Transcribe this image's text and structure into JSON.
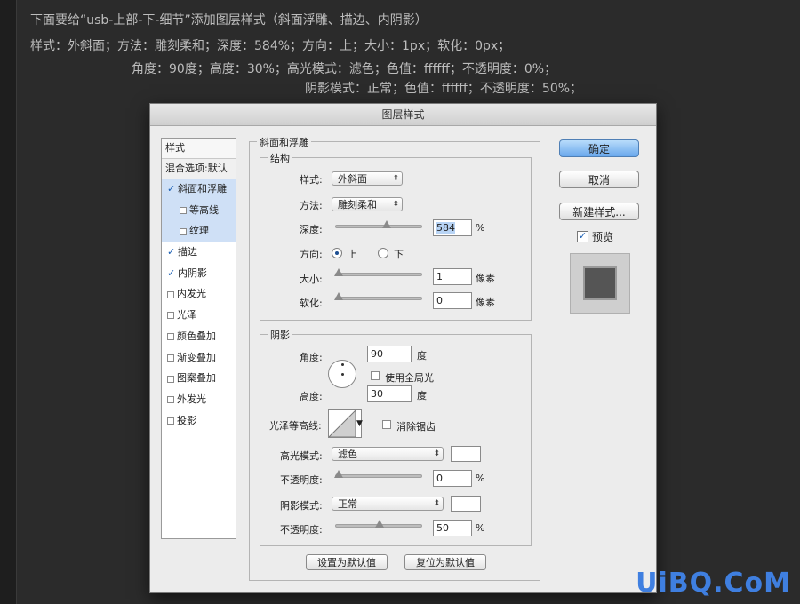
{
  "header": {
    "line1": "下面要给“usb-上部-下-细节”添加图层样式（斜面浮雕、描边、内阴影）",
    "line2": "样式：外斜面；方法：雕刻柔和；深度：584%；方向：上；大小：1px；软化：0px；",
    "line3": "角度：90度；高度：30%；高光模式：滤色；色值：ffffff；不透明度：0%；",
    "line4": "阴影模式：正常；色值：ffffff；不透明度：50%；"
  },
  "dialog": {
    "title": "图层样式",
    "style_list": {
      "header": "样式",
      "blend": "混合选项:默认",
      "items": [
        {
          "label": "斜面和浮雕",
          "checked": true,
          "selected": true
        },
        {
          "label": "等高线",
          "checked": false,
          "selected": true,
          "sub": true
        },
        {
          "label": "纹理",
          "checked": false,
          "selected": true,
          "sub": true
        },
        {
          "label": "描边",
          "checked": true
        },
        {
          "label": "内阴影",
          "checked": true
        },
        {
          "label": "内发光",
          "checked": false
        },
        {
          "label": "光泽",
          "checked": false
        },
        {
          "label": "颜色叠加",
          "checked": false
        },
        {
          "label": "渐变叠加",
          "checked": false
        },
        {
          "label": "图案叠加",
          "checked": false
        },
        {
          "label": "外发光",
          "checked": false
        },
        {
          "label": "投影",
          "checked": false
        }
      ]
    },
    "buttons": {
      "ok": "确定",
      "cancel": "取消",
      "new_style": "新建样式...",
      "preview": "预览"
    },
    "bevel": {
      "group_title": "斜面和浮雕",
      "structure_title": "结构",
      "style_label": "样式:",
      "style_value": "外斜面",
      "technique_label": "方法:",
      "technique_value": "雕刻柔和",
      "depth_label": "深度:",
      "depth_value": "584",
      "depth_unit": "%",
      "direction_label": "方向:",
      "direction_up": "上",
      "direction_down": "下",
      "size_label": "大小:",
      "size_value": "1",
      "size_unit": "像素",
      "soften_label": "软化:",
      "soften_value": "0",
      "soften_unit": "像素"
    },
    "shading": {
      "title": "阴影",
      "angle_label": "角度:",
      "angle_value": "90",
      "angle_unit": "度",
      "global_light": "使用全局光",
      "altitude_label": "高度:",
      "altitude_value": "30",
      "altitude_unit": "度",
      "gloss_label": "光泽等高线:",
      "antialias": "消除锯齿",
      "highlight_mode_label": "高光模式:",
      "highlight_mode_value": "滤色",
      "highlight_color": "#ffffff",
      "highlight_opacity_label": "不透明度:",
      "highlight_opacity_value": "0",
      "highlight_opacity_unit": "%",
      "shadow_mode_label": "阴影模式:",
      "shadow_mode_value": "正常",
      "shadow_color": "#ffffff",
      "shadow_opacity_label": "不透明度:",
      "shadow_opacity_value": "50",
      "shadow_opacity_unit": "%"
    },
    "footer": {
      "make_default": "设置为默认值",
      "reset_default": "复位为默认值"
    }
  },
  "watermark": "UiBQ.CoM"
}
